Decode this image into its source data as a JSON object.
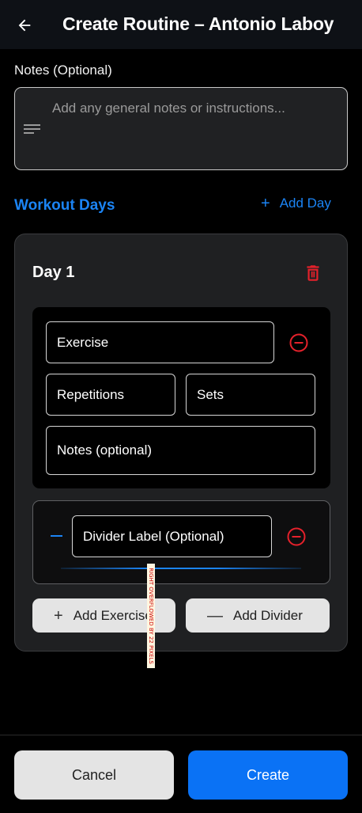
{
  "header": {
    "title": "Create Routine – Antonio Laboy",
    "back_icon": "arrow-left-icon"
  },
  "notes": {
    "label": "Notes (Optional)",
    "placeholder": "Add any general notes or instructions...",
    "icon": "notes-lines-icon"
  },
  "workout_days": {
    "section_title": "Workout Days",
    "add_day_label": "Add Day",
    "days": [
      {
        "title": "Day 1",
        "exercise": {
          "exercise_placeholder": "Exercise",
          "repetitions_placeholder": "Repetitions",
          "sets_placeholder": "Sets",
          "notes_placeholder": "Notes (optional)"
        },
        "divider": {
          "label_placeholder": "Divider Label (Optional)"
        },
        "add_exercise_label": "Add Exercise",
        "add_divider_label": "Add Divider"
      }
    ]
  },
  "overflow_warning": "RIGHT OVERFLOWED BY 22 PIXELS",
  "footer": {
    "cancel_label": "Cancel",
    "create_label": "Create"
  },
  "colors": {
    "accent": "#1b84f5",
    "primary_button": "#0a72f5",
    "danger": "#e5212b",
    "background": "#000000",
    "card": "#1f2022"
  }
}
